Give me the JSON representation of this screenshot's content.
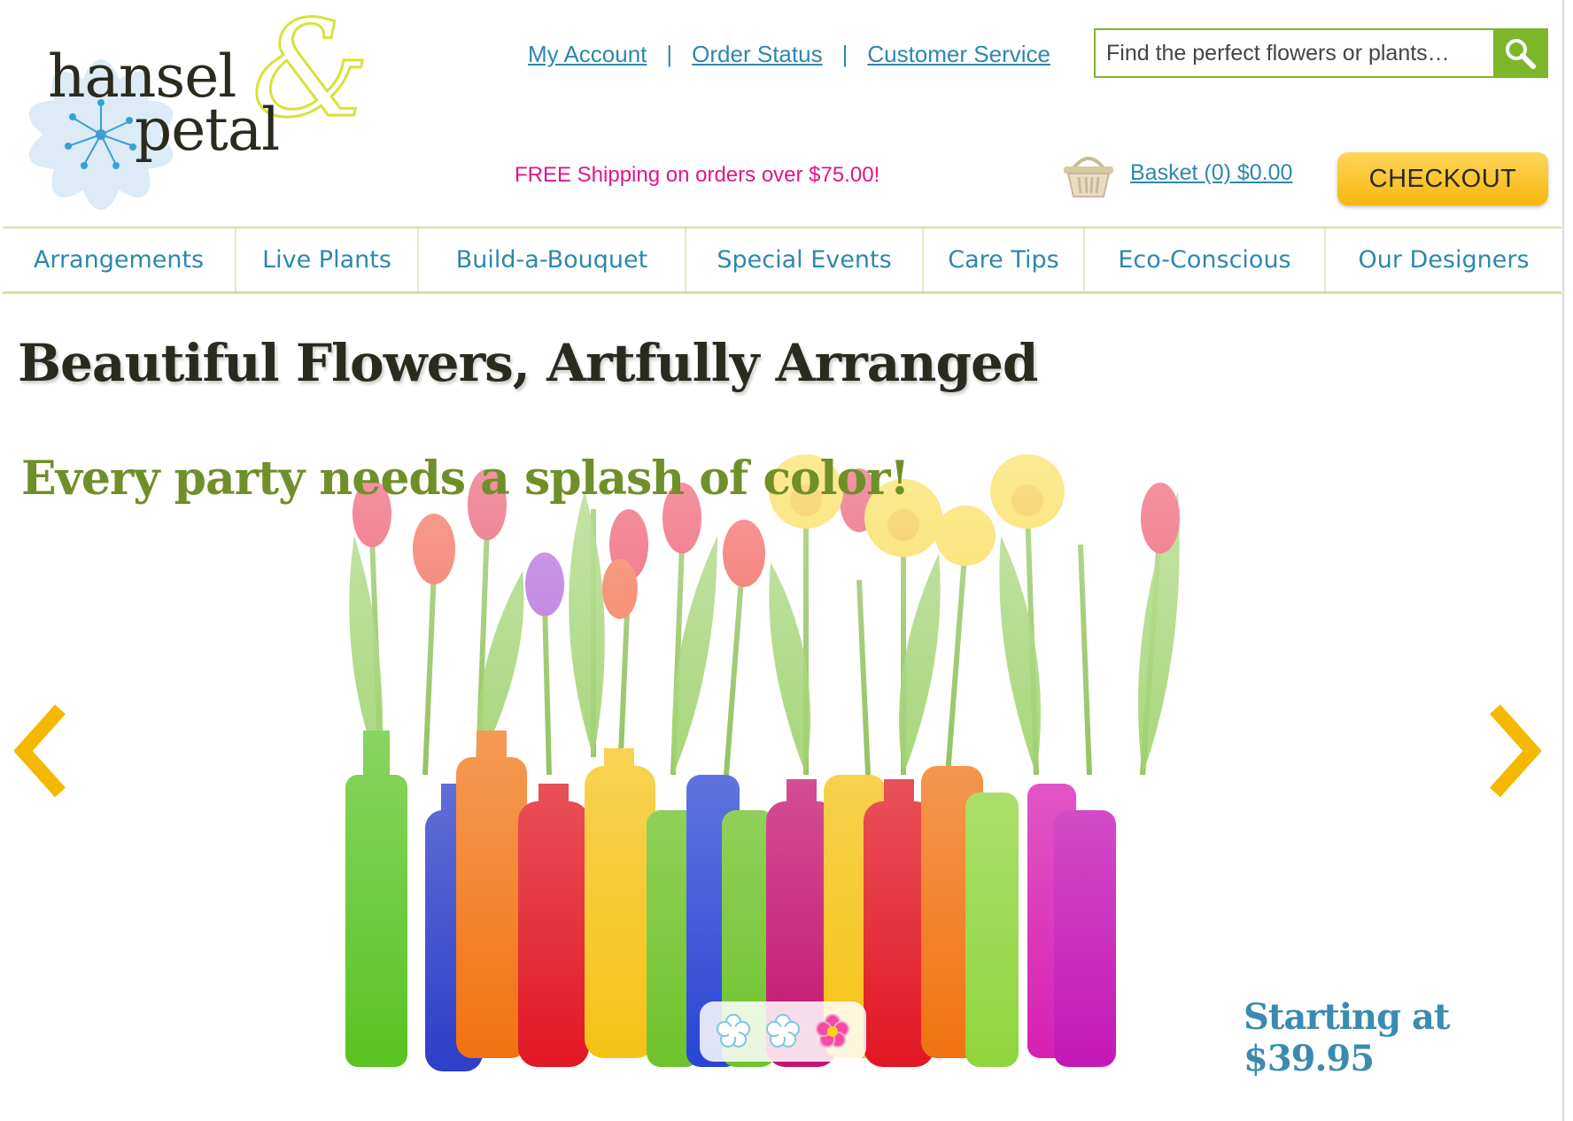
{
  "logo": {
    "line1": "hansel",
    "line2": "petal",
    "ampersand": "&"
  },
  "header": {
    "links": [
      "My Account",
      "Order Status",
      "Customer Service"
    ],
    "separator": "|"
  },
  "search": {
    "placeholder": "Find the perfect flowers or plants…"
  },
  "shipping_text": "FREE Shipping on orders over $75.00!",
  "basket": {
    "label": "Basket (0) $0.00"
  },
  "checkout_label": "CHECKOUT",
  "nav": [
    "Arrangements",
    "Live Plants",
    "Build-a-Bouquet",
    "Special Events",
    "Care Tips",
    "Eco-Conscious",
    "Our Designers"
  ],
  "headline": "Beautiful Flowers, Artfully Arranged",
  "promo": {
    "title": "Every party needs a splash of color!",
    "price": "Starting at $39.95"
  },
  "carousel": {
    "slides": 3,
    "active_slide": 3
  },
  "colors": {
    "link_blue": "#2e88ad",
    "green": "#7eb62a",
    "promo_green": "#6f8f28",
    "pink": "#e0168a",
    "checkout_yellow": "#f6b60e",
    "arrow_yellow": "#f5b800"
  }
}
